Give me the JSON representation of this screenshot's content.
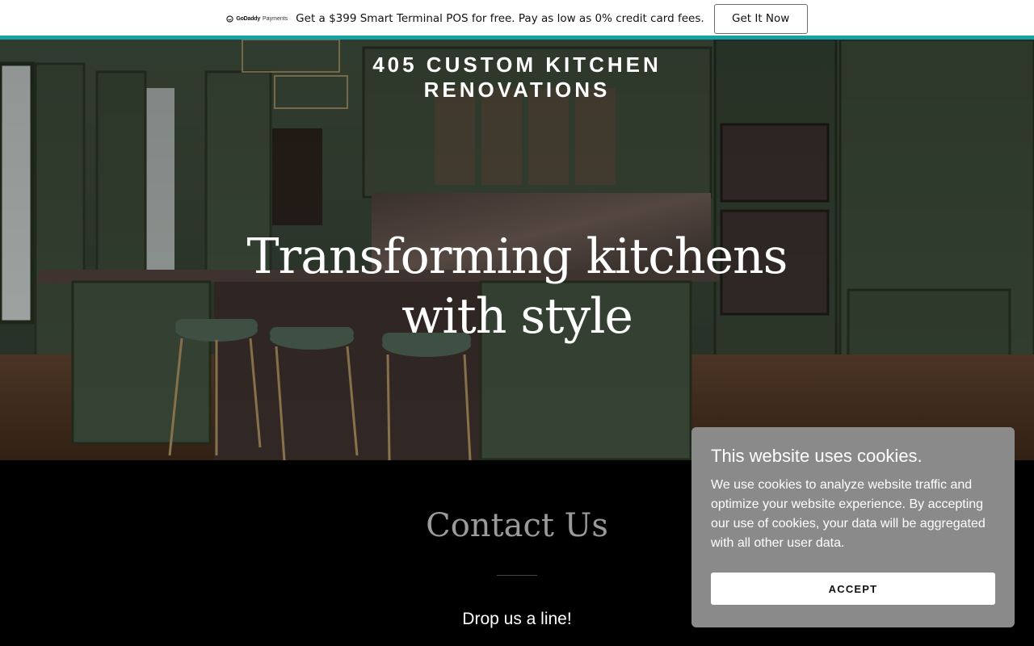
{
  "promo": {
    "brand": "GoDaddy",
    "brand_sub": "Payments",
    "message": "Get a $399 Smart Terminal POS for free. Pay as low as 0% credit card fees.",
    "cta_label": "Get It Now",
    "accent_color": "#14a3a5"
  },
  "hero": {
    "site_title_line1": "405 CUSTOM KITCHEN",
    "site_title_line2": "RENOVATIONS",
    "headline": "Transforming kitchens with style",
    "background": "green kitchen cabinets with marble island and bar stools"
  },
  "contact": {
    "title": "Contact Us",
    "subtitle": "Drop us a line!"
  },
  "cookie_banner": {
    "title": "This website uses cookies.",
    "body": "We use cookies to analyze website traffic and optimize your website experience. By accepting our use of cookies, your data will be aggregated with all other user data.",
    "accept_label": "ACCEPT"
  }
}
